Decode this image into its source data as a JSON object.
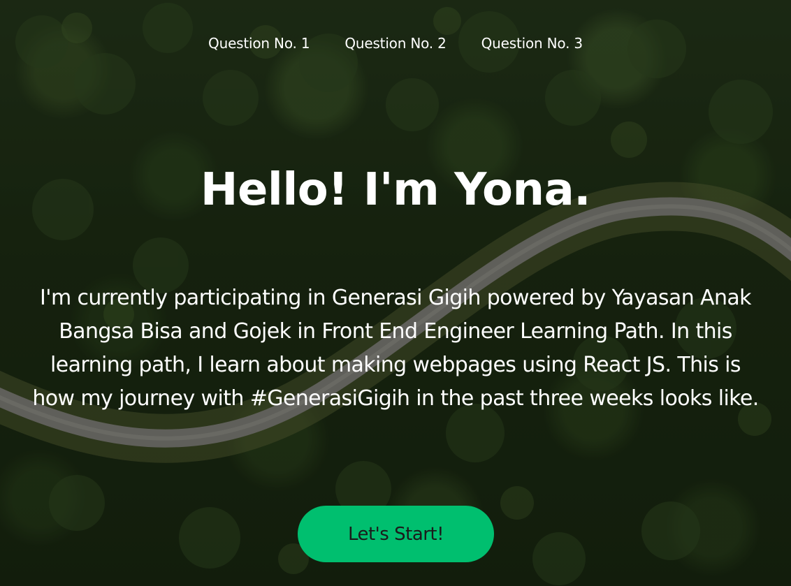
{
  "nav": {
    "items": [
      {
        "label": "Question No. 1"
      },
      {
        "label": "Question No. 2"
      },
      {
        "label": "Question No. 3"
      }
    ]
  },
  "hero": {
    "title": "Hello! I'm Yona.",
    "description": "I'm currently participating in Generasi Gigih powered by Yayasan Anak Bangsa Bisa and Gojek in Front End Engineer Learning Path. In this learning path, I learn about making webpages using React JS. This is how my journey with #GenerasiGigih in the past three weeks looks like.",
    "cta_label": "Let's Start!"
  },
  "colors": {
    "accent": "#00bf6f",
    "text": "#ffffff",
    "cta_text": "#1b1b1b"
  }
}
